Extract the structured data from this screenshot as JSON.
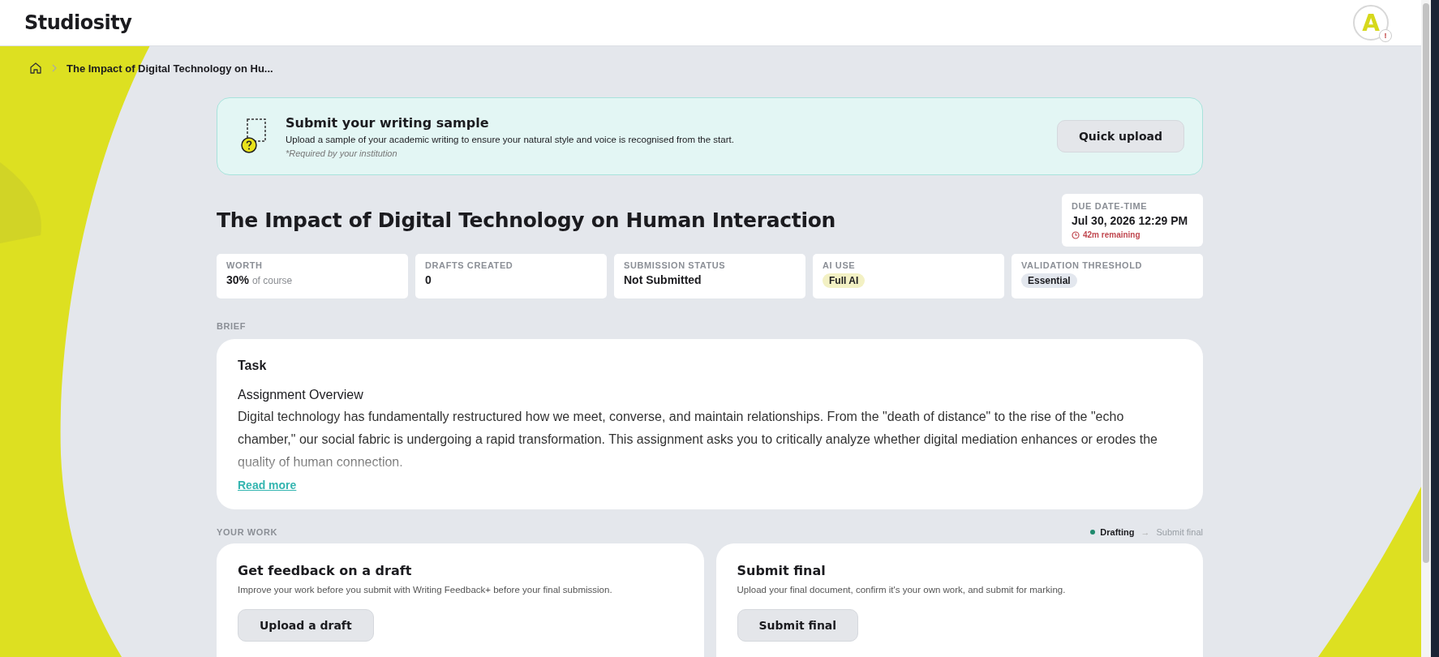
{
  "header": {
    "logo": "Studiosity",
    "avatar": {
      "initial": "A",
      "alert": "!"
    }
  },
  "breadcrumb": {
    "current": "The Impact of Digital Technology on Hu..."
  },
  "banner": {
    "title": "Submit your writing sample",
    "text": "Upload a sample of your academic writing to ensure your natural style and voice is recognised from the start.",
    "note": "*Required by your institution",
    "button": "Quick upload"
  },
  "assignment": {
    "title": "The Impact of Digital Technology on Human Interaction",
    "due": {
      "label": "DUE DATE-TIME",
      "value": "Jul 30, 2026 12:29 PM",
      "remaining": "42m remaining"
    }
  },
  "stats": [
    {
      "kind": "text",
      "label": "WORTH",
      "value": "30%",
      "suffix": "of course"
    },
    {
      "kind": "text",
      "label": "DRAFTS CREATED",
      "value": "0"
    },
    {
      "kind": "text",
      "label": "SUBMISSION STATUS",
      "value": "Not Submitted"
    },
    {
      "kind": "tag",
      "label": "AI USE",
      "value": "Full AI",
      "color": "#f3f1c4"
    },
    {
      "kind": "tag",
      "label": "VALIDATION THRESHOLD",
      "value": "Essential",
      "color": "#e3e7ee"
    }
  ],
  "brief": {
    "label": "BRIEF",
    "title": "Task",
    "subtitle": "Assignment Overview",
    "text": "Digital technology has fundamentally restructured how we meet, converse, and maintain relationships. From the \"death of distance\" to the rise of the \"echo chamber,\" our social fabric is undergoing a rapid transformation. This assignment asks you to critically analyze whether digital mediation enhances or erodes the quality of human connection.",
    "link": "Read more"
  },
  "work": {
    "label": "YOUR WORK",
    "steps": [
      {
        "label": "Drafting",
        "selected": true
      },
      {
        "label": "Submit final",
        "selected": false
      }
    ],
    "arrow": "→",
    "cards": [
      {
        "title": "Get feedback on a draft",
        "text": "Improve your work before you submit with Writing Feedback+ before your final submission.",
        "button": "Upload a draft"
      },
      {
        "title": "Submit final",
        "text": "Upload your final document, confirm it's your own work, and submit for marking.",
        "button": "Submit final"
      }
    ]
  }
}
